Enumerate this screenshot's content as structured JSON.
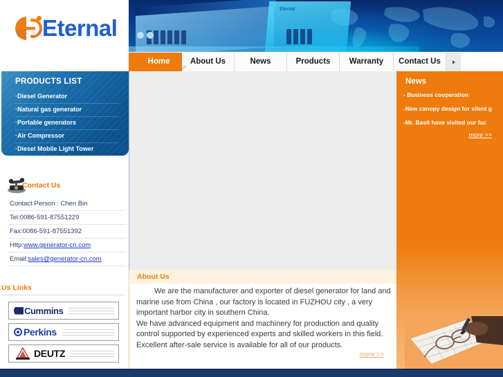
{
  "site": {
    "logo_text": "Eternal",
    "logo_mark": "eternal-e-mark"
  },
  "banner": {
    "inline_logo": "Eternal"
  },
  "nav": {
    "items": [
      {
        "label": "Home",
        "active": true
      },
      {
        "label": "About Us",
        "active": false
      },
      {
        "label": "News",
        "active": false
      },
      {
        "label": "Products",
        "active": false
      },
      {
        "label": "Warranty",
        "active": false
      },
      {
        "label": "Contact Us",
        "active": false
      }
    ],
    "more_arrow": "▸"
  },
  "sidebar": {
    "products": {
      "title": "PRODUCTS LIST",
      "items": [
        "·Diesel Generator",
        "·Natural gas generator",
        "·Portable generators",
        "·Air Compressor",
        "·Diesel Mobile Light Tower"
      ]
    },
    "contact": {
      "title": "Contact Us",
      "rows": [
        {
          "label": "Contact Person : Chen Bin",
          "link": ""
        },
        {
          "label": "Tel:0086-591-87551229",
          "link": ""
        },
        {
          "label": "Fax:0086-591-87551392",
          "link": ""
        },
        {
          "label": "Http:",
          "link": "www.generator-cn.com"
        },
        {
          "label": "Email:",
          "link": "sales@generator-cn.com"
        }
      ]
    },
    "us_links": {
      "title": "Us Links",
      "items": [
        "Cummins",
        "Perkins",
        "DEUTZ"
      ]
    }
  },
  "news": {
    "title": "News",
    "items": [
      "-     Business cooperation",
      "-New canopy design for silent g",
      "-Mr. Basit have visited our fac"
    ],
    "more_label": "more >>"
  },
  "about": {
    "title": "About Us",
    "paragraph_1": "We are the manufacturer and exporter of diesel generator for land and marine use from China , our factory is located in FUZHOU city , a very important harbor city in southern China.",
    "paragraph_2": "We have advanced equipment and machinery for production and quality control supported by experienced experts and skilled workers in this field. Excellent after-sale service is available for all of our products.",
    "more_label": "more >>"
  },
  "colors": {
    "brand_orange": "#EE7B0D",
    "brand_blue": "#1F5FD0",
    "panel_blue": "#1262A0",
    "content_gray": "#EDEDED",
    "footer_navy": "#1A3A6B"
  }
}
